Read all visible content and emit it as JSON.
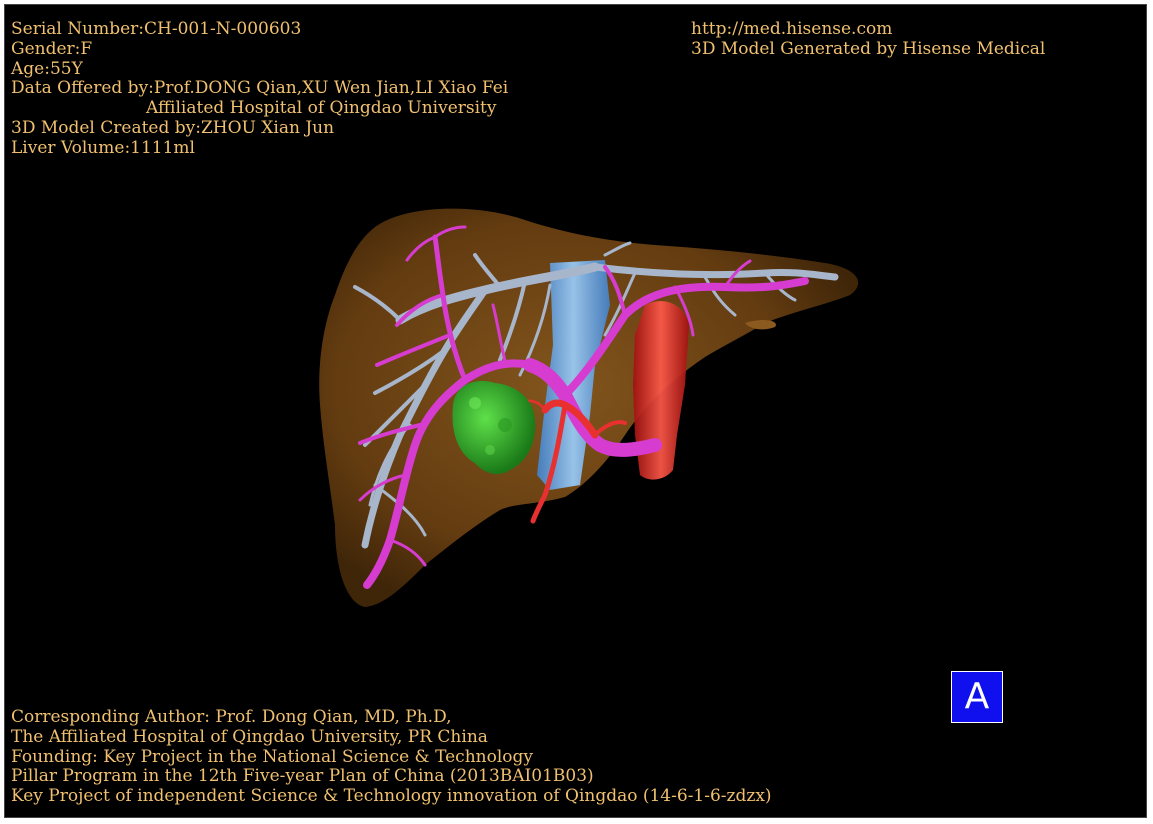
{
  "header_left": {
    "serial": "Serial Number:CH-001-N-000603",
    "gender": "Gender:F",
    "age": "Age:55Y",
    "data_offered": "Data Offered by:Prof.DONG Qian,XU Wen Jian,LI Xiao Fei",
    "hospital": "Affiliated Hospital of Qingdao University",
    "model_created": "3D Model Created by:ZHOU Xian Jun",
    "liver_volume": "Liver Volume:1111ml"
  },
  "header_right": {
    "url": "http://med.hisense.com",
    "generated": "3D Model Generated by Hisense Medical"
  },
  "footer": {
    "line1": "Corresponding Author: Prof. Dong Qian, MD, Ph.D,",
    "line2": "The Affiliated Hospital of Qingdao University, PR China",
    "line3": "Founding: Key Project in the National Science & Technology",
    "line4": "Pillar Program in the 12th Five-year Plan of China (2013BAI01B03)",
    "line5": "Key Project of independent Science & Technology innovation of Qingdao (14-6-1-6-zdzx)"
  },
  "badge_label": "A",
  "colors": {
    "text": "#f0c070",
    "background": "#000000",
    "liver": "#7a4a14",
    "portal_vein": "#d63ccf",
    "hepatic_vein": "#a8b6cc",
    "tumor": "#2fa82a",
    "ivc": "#5aa8ee",
    "aorta": "#d82020",
    "badge": "#1010ee"
  }
}
